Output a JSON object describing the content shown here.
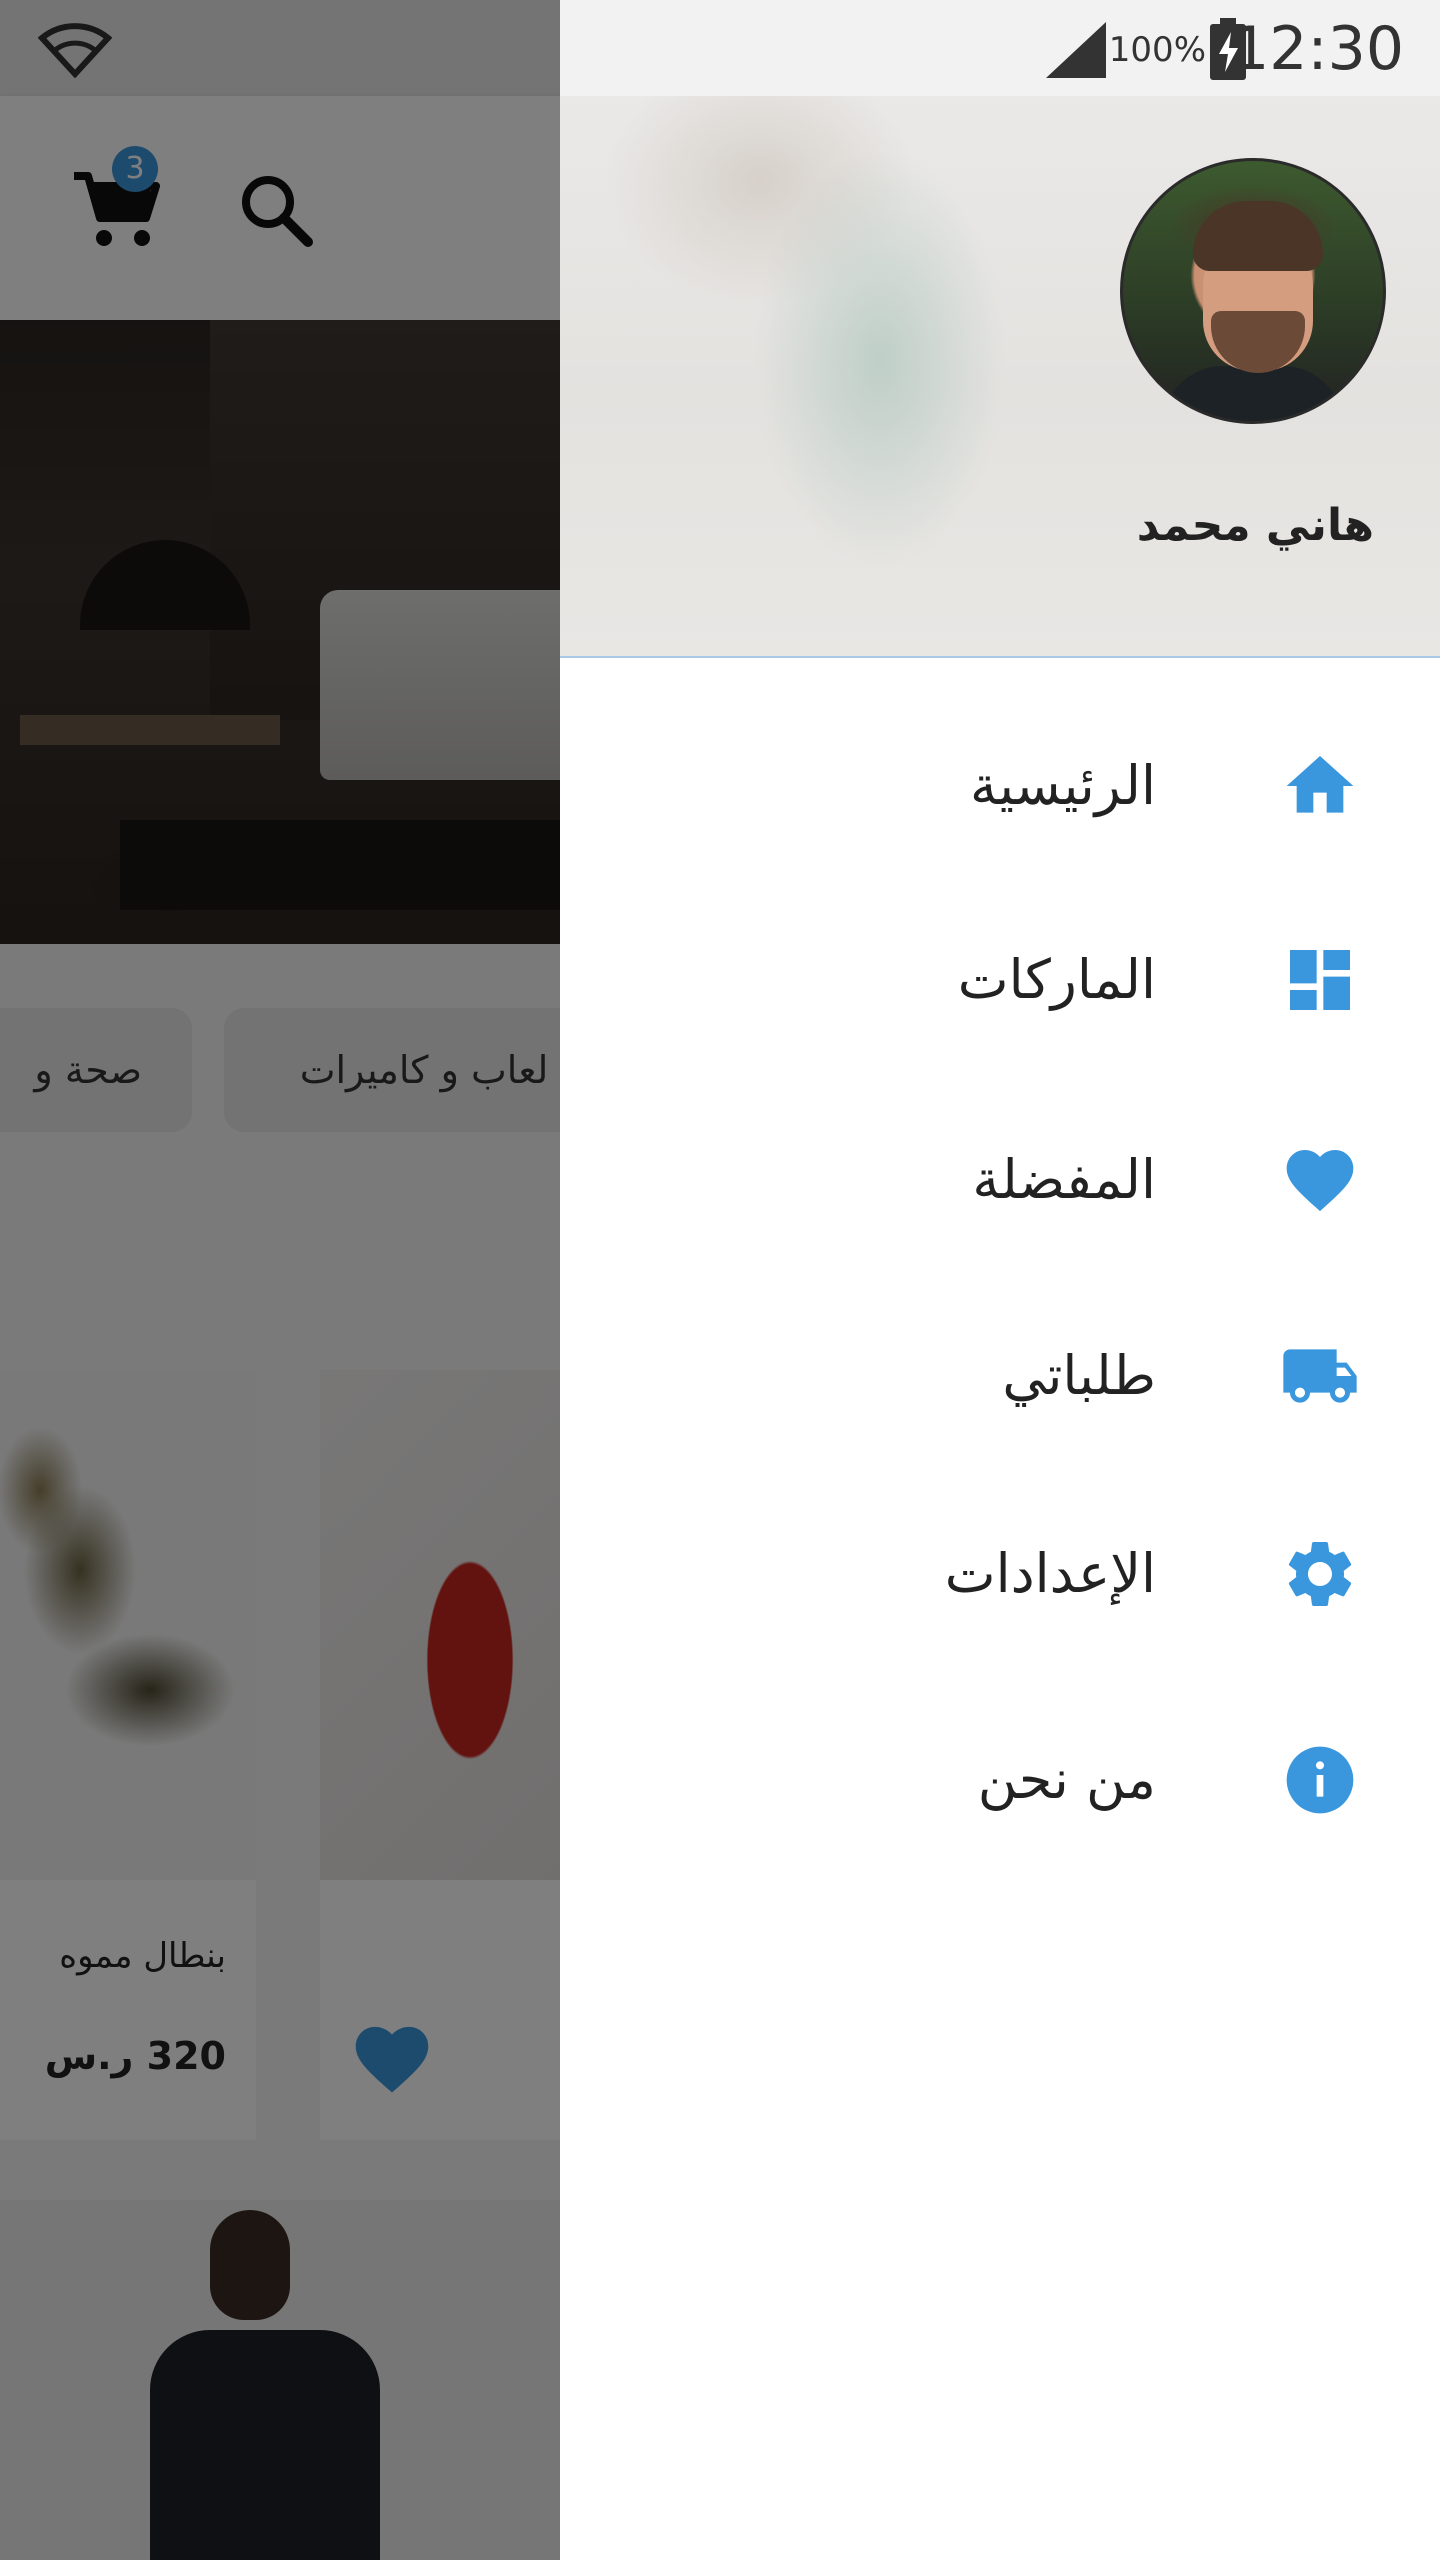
{
  "status_bar": {
    "time": "12:30",
    "battery": "100%"
  },
  "background": {
    "cart_count": "3",
    "chips": [
      "صحة و",
      "لعاب و كاميرات"
    ],
    "product_1": {
      "title": "بنطال مموه",
      "price": "320 ر.س"
    }
  },
  "drawer": {
    "user_name": "هاني محمد",
    "menu": [
      {
        "label": "الرئيسية",
        "icon": "home-icon"
      },
      {
        "label": "الماركات",
        "icon": "dashboard-icon"
      },
      {
        "label": "المفضلة",
        "icon": "heart-icon"
      },
      {
        "label": "طلباتي",
        "icon": "truck-icon"
      },
      {
        "label": "الإعدادات",
        "icon": "gear-icon"
      },
      {
        "label": "من نحن",
        "icon": "info-icon"
      }
    ]
  },
  "colors": {
    "accent": "#3a97dd",
    "badge": "#3a97dd",
    "scrim": "rgba(0,0,0,0.5)"
  }
}
